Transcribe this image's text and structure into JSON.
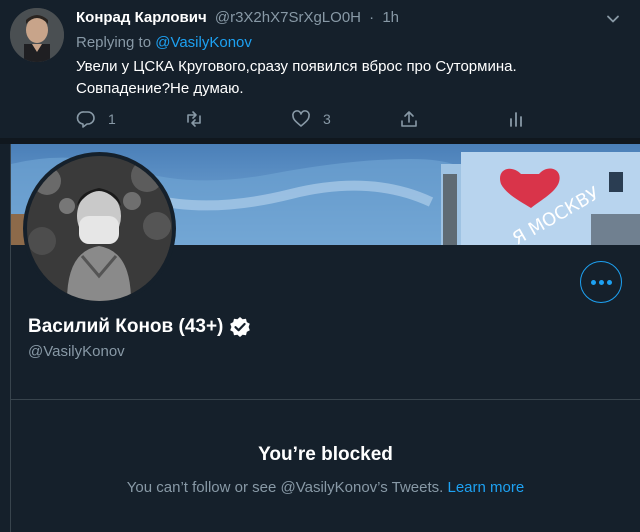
{
  "tweet": {
    "author_name": "Конрад Карлович",
    "author_handle": "@r3X2hX7SrXgLO0H",
    "separator": "·",
    "time": "1h",
    "replying_label": "Replying to",
    "replying_handle": "@VasilyKonov",
    "text_line1": "Увели у ЦСКА Кругового,сразу появился вброс про Сутормина.",
    "text_line2": "Совпадение?Не думаю.",
    "reply_count": "1",
    "like_count": "3"
  },
  "profile": {
    "name": "Василий Конов (43+)",
    "handle": "@VasilyKonov",
    "blocked_title": "You’re blocked",
    "blocked_text": "You can’t follow or see @VasilyKonov’s Tweets.",
    "learn_more": "Learn more"
  },
  "icons": {
    "reply": "reply-icon",
    "retweet": "retweet-icon",
    "like": "heart-icon",
    "share": "share-icon",
    "analytics": "analytics-icon",
    "caret": "chevron-down-icon",
    "verified": "verified-badge-icon",
    "more": "more-icon"
  },
  "colors": {
    "background": "#15202b",
    "accent": "#1da1f2",
    "secondary_text": "#8899a6",
    "primary_text": "#ffffff",
    "border": "#38444d"
  }
}
